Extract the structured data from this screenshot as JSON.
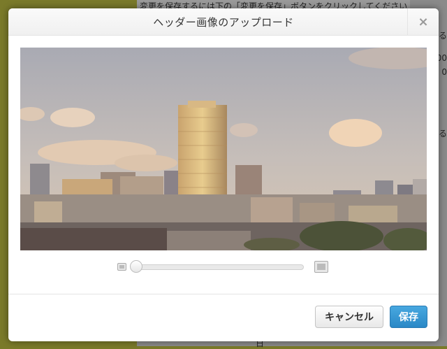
{
  "background": {
    "notice": "変更を保存するには下の「変更を保存」ボタンをクリックしてください",
    "side_char_1": "る",
    "side_num_1": "00",
    "side_num_2": "0",
    "side_char_2": "る",
    "bottom_text": "日"
  },
  "modal": {
    "title": "ヘッダー画像のアップロード",
    "close_label": "×",
    "zoom": {
      "level": 0.0
    },
    "cancel_label": "キャンセル",
    "save_label": "保存"
  },
  "colors": {
    "primary_button": "#2a88c6",
    "overlay": "#7a7a2a"
  }
}
